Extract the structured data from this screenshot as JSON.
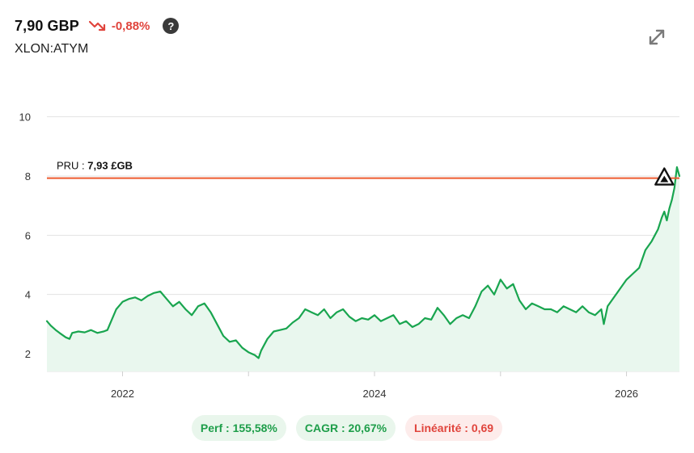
{
  "header": {
    "price": "7,90 GBP",
    "change": "-0,88%",
    "change_color": "#e0443c",
    "change_icon": "trending-down-icon",
    "help_icon": "question-icon",
    "ticker": "XLON:ATYM",
    "expand_icon": "expand-arrows-icon"
  },
  "colors": {
    "series": "#19a54f",
    "area_fill": "#e9f7ee",
    "pru_line": "#ee5a2f",
    "grid": "#e3e3e3",
    "text": "#333333"
  },
  "chart_data": {
    "type": "line",
    "x_ticks": [
      {
        "label": "2022",
        "value": 2022.0
      },
      {
        "label": "2024",
        "value": 2024.0
      },
      {
        "label": "2026",
        "value": 2026.0
      }
    ],
    "x_minor_ticks": [
      2023.0,
      2025.0
    ],
    "y_ticks": [
      2,
      4,
      6,
      8,
      10
    ],
    "ylim": [
      1.4,
      11.0
    ],
    "xlim": [
      2021.4,
      2026.42
    ],
    "grid": true,
    "reference_line": {
      "label_prefix": "PRU : ",
      "label_value": "7,93 £GB",
      "value": 7.93
    },
    "marker": {
      "x": 2026.3,
      "y": 7.93,
      "shape": "triangle"
    },
    "series": [
      {
        "points": [
          [
            2021.4,
            3.1
          ],
          [
            2021.43,
            2.95
          ],
          [
            2021.47,
            2.8
          ],
          [
            2021.5,
            2.7
          ],
          [
            2021.55,
            2.55
          ],
          [
            2021.58,
            2.5
          ],
          [
            2021.6,
            2.7
          ],
          [
            2021.65,
            2.75
          ],
          [
            2021.7,
            2.72
          ],
          [
            2021.75,
            2.8
          ],
          [
            2021.8,
            2.7
          ],
          [
            2021.85,
            2.75
          ],
          [
            2021.88,
            2.8
          ],
          [
            2021.9,
            3.0
          ],
          [
            2021.95,
            3.5
          ],
          [
            2022.0,
            3.75
          ],
          [
            2022.05,
            3.85
          ],
          [
            2022.1,
            3.9
          ],
          [
            2022.15,
            3.8
          ],
          [
            2022.2,
            3.95
          ],
          [
            2022.25,
            4.05
          ],
          [
            2022.3,
            4.1
          ],
          [
            2022.35,
            3.85
          ],
          [
            2022.4,
            3.6
          ],
          [
            2022.45,
            3.75
          ],
          [
            2022.5,
            3.5
          ],
          [
            2022.55,
            3.3
          ],
          [
            2022.6,
            3.6
          ],
          [
            2022.65,
            3.7
          ],
          [
            2022.7,
            3.4
          ],
          [
            2022.75,
            3.0
          ],
          [
            2022.8,
            2.6
          ],
          [
            2022.85,
            2.4
          ],
          [
            2022.9,
            2.45
          ],
          [
            2022.95,
            2.2
          ],
          [
            2023.0,
            2.05
          ],
          [
            2023.05,
            1.95
          ],
          [
            2023.08,
            1.85
          ],
          [
            2023.1,
            2.1
          ],
          [
            2023.15,
            2.5
          ],
          [
            2023.2,
            2.75
          ],
          [
            2023.25,
            2.8
          ],
          [
            2023.3,
            2.85
          ],
          [
            2023.35,
            3.05
          ],
          [
            2023.4,
            3.2
          ],
          [
            2023.45,
            3.5
          ],
          [
            2023.5,
            3.4
          ],
          [
            2023.55,
            3.3
          ],
          [
            2023.6,
            3.5
          ],
          [
            2023.65,
            3.2
          ],
          [
            2023.7,
            3.4
          ],
          [
            2023.75,
            3.5
          ],
          [
            2023.8,
            3.25
          ],
          [
            2023.85,
            3.1
          ],
          [
            2023.9,
            3.2
          ],
          [
            2023.95,
            3.15
          ],
          [
            2024.0,
            3.3
          ],
          [
            2024.05,
            3.1
          ],
          [
            2024.1,
            3.2
          ],
          [
            2024.15,
            3.3
          ],
          [
            2024.2,
            3.0
          ],
          [
            2024.25,
            3.1
          ],
          [
            2024.3,
            2.9
          ],
          [
            2024.35,
            3.0
          ],
          [
            2024.4,
            3.2
          ],
          [
            2024.45,
            3.15
          ],
          [
            2024.5,
            3.55
          ],
          [
            2024.55,
            3.3
          ],
          [
            2024.6,
            3.0
          ],
          [
            2024.65,
            3.2
          ],
          [
            2024.7,
            3.3
          ],
          [
            2024.75,
            3.2
          ],
          [
            2024.8,
            3.6
          ],
          [
            2024.85,
            4.1
          ],
          [
            2024.9,
            4.3
          ],
          [
            2024.95,
            4.0
          ],
          [
            2025.0,
            4.5
          ],
          [
            2025.05,
            4.2
          ],
          [
            2025.1,
            4.35
          ],
          [
            2025.15,
            3.8
          ],
          [
            2025.2,
            3.5
          ],
          [
            2025.25,
            3.7
          ],
          [
            2025.3,
            3.6
          ],
          [
            2025.35,
            3.5
          ],
          [
            2025.4,
            3.5
          ],
          [
            2025.45,
            3.4
          ],
          [
            2025.5,
            3.6
          ],
          [
            2025.55,
            3.5
          ],
          [
            2025.6,
            3.4
          ],
          [
            2025.65,
            3.6
          ],
          [
            2025.7,
            3.4
          ],
          [
            2025.75,
            3.3
          ],
          [
            2025.8,
            3.5
          ],
          [
            2025.82,
            3.0
          ],
          [
            2025.85,
            3.6
          ],
          [
            2025.9,
            3.9
          ],
          [
            2025.95,
            4.2
          ],
          [
            2026.0,
            4.5
          ],
          [
            2026.05,
            4.7
          ],
          [
            2026.1,
            4.9
          ],
          [
            2026.15,
            5.5
          ],
          [
            2026.2,
            5.8
          ],
          [
            2026.25,
            6.2
          ],
          [
            2026.28,
            6.6
          ],
          [
            2026.3,
            6.8
          ],
          [
            2026.32,
            6.5
          ],
          [
            2026.34,
            6.9
          ],
          [
            2026.36,
            7.2
          ],
          [
            2026.38,
            7.6
          ],
          [
            2026.4,
            8.3
          ],
          [
            2026.42,
            8.0
          ]
        ]
      }
    ]
  },
  "metrics": [
    {
      "label": "Perf : 155,58%",
      "tone": "green"
    },
    {
      "label": "CAGR : 20,67%",
      "tone": "green"
    },
    {
      "label": "Linéarité : 0,69",
      "tone": "red"
    }
  ]
}
